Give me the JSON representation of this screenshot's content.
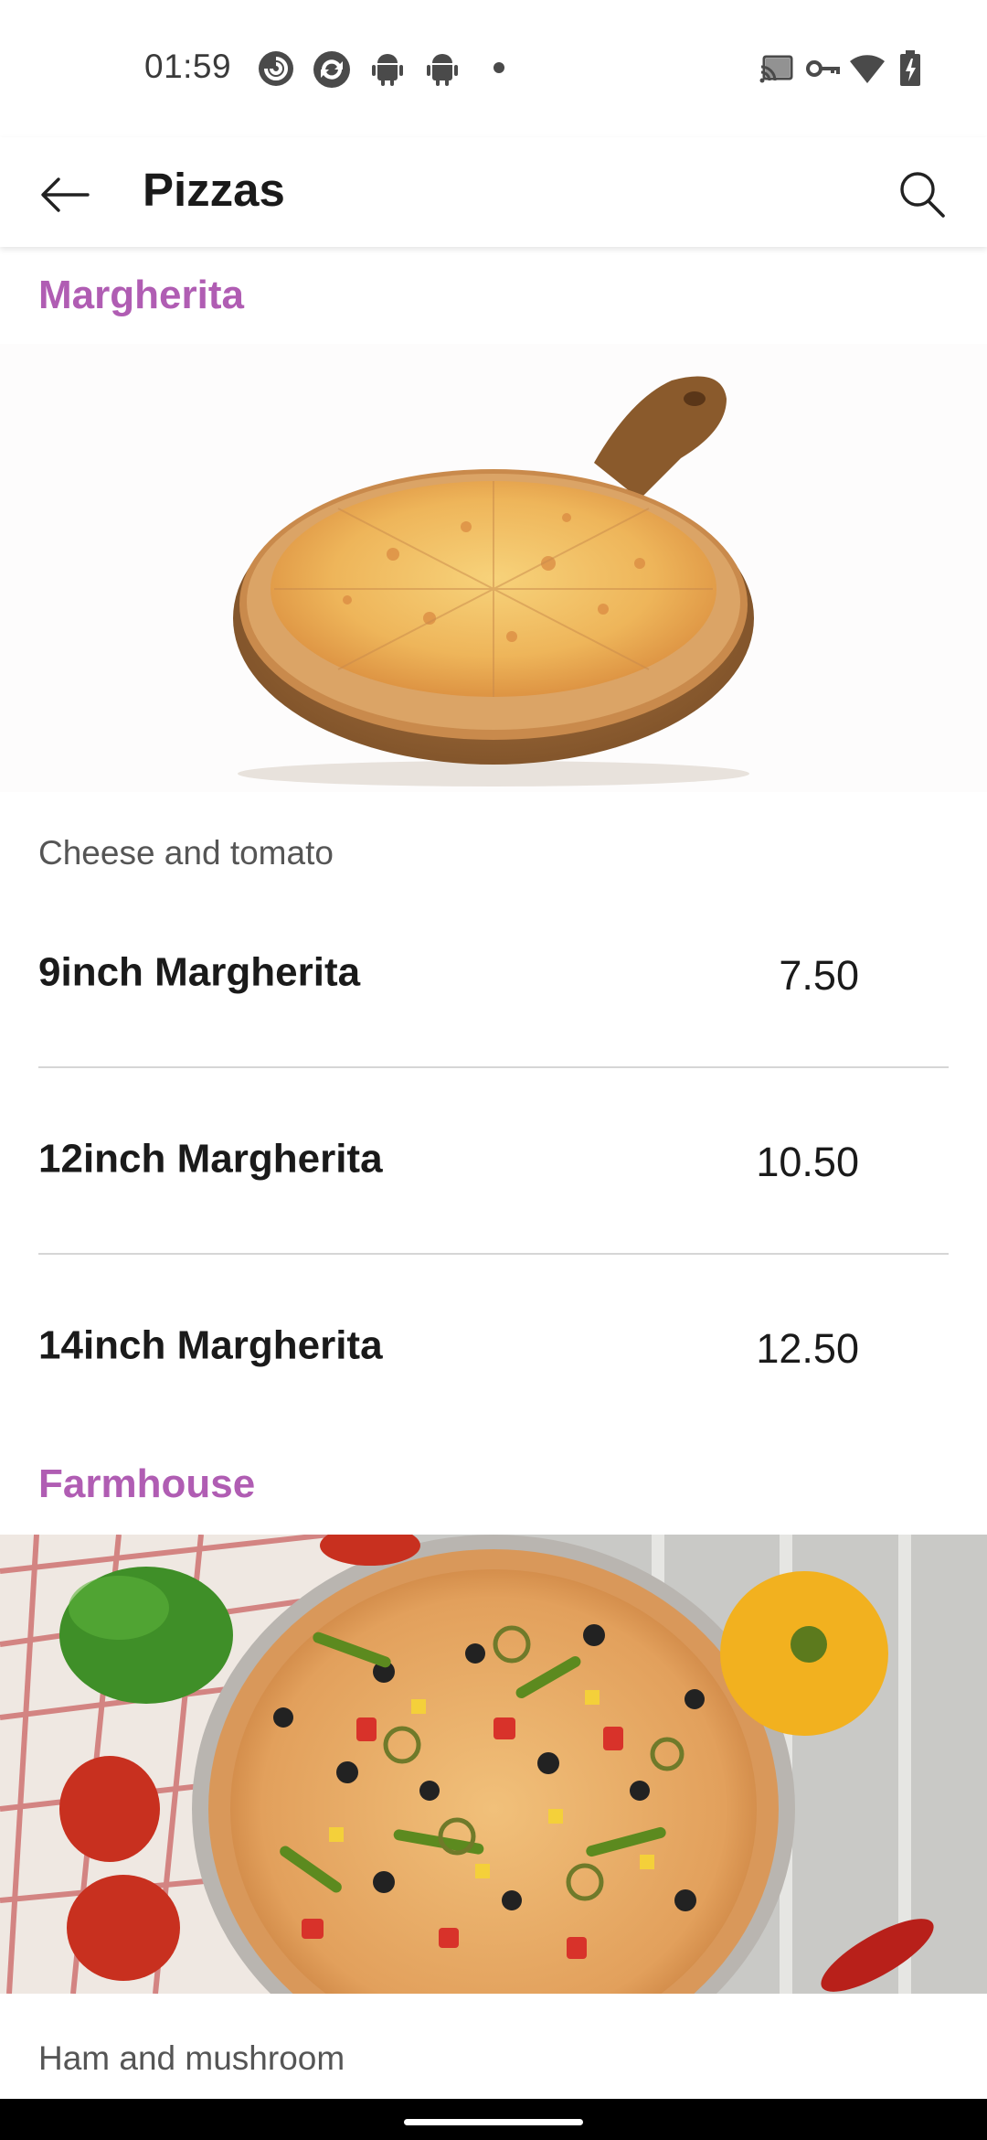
{
  "status_bar": {
    "time": "01:59",
    "left_icons": [
      "pocket-casts-icon",
      "sync-app-icon",
      "android-icon",
      "android-icon",
      "notification-dot-icon"
    ],
    "right_icons": [
      "cast-icon",
      "vpn-key-icon",
      "wifi-icon",
      "battery-charging-icon"
    ]
  },
  "app_bar": {
    "title": "Pizzas",
    "back_icon": "arrow-left-icon",
    "search_icon": "search-icon"
  },
  "colors": {
    "accent": "#b05db3",
    "divider": "#d6d6d6",
    "text_primary": "#1a1a1a",
    "text_secondary": "#555555"
  },
  "sections": [
    {
      "title": "Margherita",
      "description": "Cheese and tomato",
      "items": [
        {
          "name": "9inch Margherita",
          "price": "7.50"
        },
        {
          "name": "12inch Margherita",
          "price": "10.50"
        },
        {
          "name": "14inch Margherita",
          "price": "12.50"
        }
      ]
    },
    {
      "title": "Farmhouse",
      "description": "Ham and mushroom",
      "items": []
    }
  ]
}
